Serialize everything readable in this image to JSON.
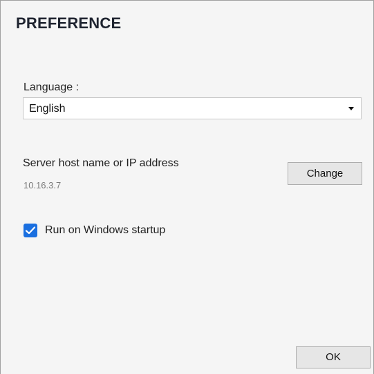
{
  "dialog": {
    "title": "PREFERENCE"
  },
  "language": {
    "label": "Language :",
    "selected": "English"
  },
  "server": {
    "label": "Server host name or IP address",
    "value": "10.16.3.7",
    "change_label": "Change"
  },
  "startup": {
    "label": "Run on Windows startup",
    "checked": true
  },
  "footer": {
    "ok_label": "OK"
  },
  "colors": {
    "checkbox_accent": "#1a6fe0",
    "background": "#f5f5f5"
  },
  "icons": {
    "dropdown": "chevron-down-icon",
    "checkbox_mark": "checkmark-icon"
  }
}
